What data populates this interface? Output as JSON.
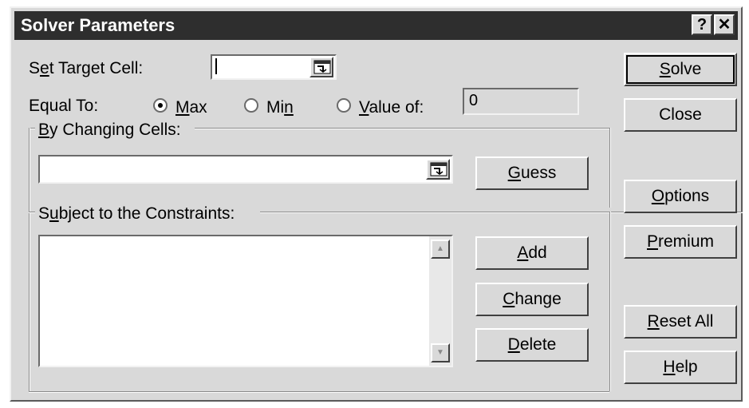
{
  "dialog": {
    "title": "Solver Parameters",
    "help_icon": "?",
    "close_icon": "✕"
  },
  "target": {
    "label_pre": "S",
    "label_u": "e",
    "label_post": "t Target Cell:",
    "value": ""
  },
  "equal_to": {
    "label": "Equal To:",
    "selected": "Max",
    "max": {
      "u": "M",
      "rest": "ax"
    },
    "min": {
      "pre": "Mi",
      "u": "n"
    },
    "value_of": {
      "u": "V",
      "rest": "alue of:"
    },
    "value_field": "0"
  },
  "changing": {
    "label_u": "B",
    "label_rest": "y Changing Cells:",
    "value": ""
  },
  "constraints": {
    "label_pre": "S",
    "label_u": "u",
    "label_rest": "bject to the Constraints:",
    "items": []
  },
  "buttons": {
    "solve": {
      "u": "S",
      "rest": "olve"
    },
    "close": "Close",
    "options": {
      "u": "O",
      "rest": "ptions"
    },
    "premium": {
      "u": "P",
      "rest": "remium"
    },
    "reset_all": {
      "u": "R",
      "rest": "eset All"
    },
    "help": {
      "u": "H",
      "rest": "elp"
    },
    "guess": {
      "u": "G",
      "rest": "uess"
    },
    "add": {
      "u": "A",
      "rest": "dd"
    },
    "change": {
      "u": "C",
      "rest": "hange"
    },
    "delete": {
      "u": "D",
      "rest": "elete"
    }
  }
}
